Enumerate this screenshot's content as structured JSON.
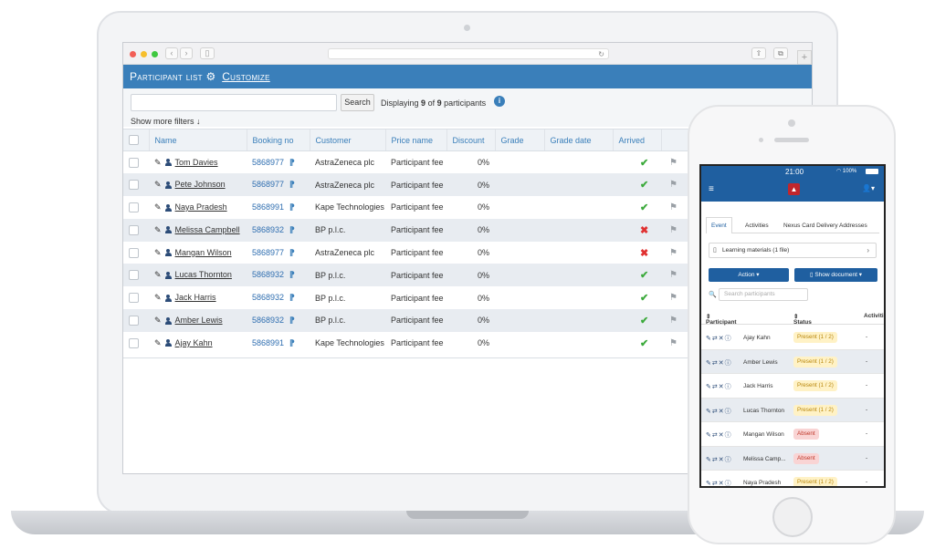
{
  "laptop": {
    "header": {
      "title": "Participant list",
      "customize_label": "Customize"
    },
    "search": {
      "placeholder": "",
      "button_label": "Search",
      "displaying_prefix": "Displaying",
      "shown": "9",
      "of_word": "of",
      "total": "9",
      "suffix": "participants"
    },
    "show_more_filters": "Show more filters",
    "columns": [
      "Name",
      "Booking no",
      "Customer",
      "Price name",
      "Discount",
      "Grade",
      "Grade date",
      "Arrived"
    ],
    "rows": [
      {
        "name": "Tom Davies",
        "booking": "5868977",
        "customer": "AstraZeneca plc",
        "price": "Participant fee",
        "discount": "0%",
        "arrived": "yes"
      },
      {
        "name": "Pete Johnson",
        "booking": "5868977",
        "customer": "AstraZeneca plc",
        "price": "Participant fee",
        "discount": "0%",
        "arrived": "yes"
      },
      {
        "name": "Naya Pradesh",
        "booking": "5868991",
        "customer": "Kape Technologies",
        "price": "Participant fee",
        "discount": "0%",
        "arrived": "yes"
      },
      {
        "name": "Melissa Campbell",
        "booking": "5868932",
        "customer": "BP p.l.c.",
        "price": "Participant fee",
        "discount": "0%",
        "arrived": "no"
      },
      {
        "name": "Mangan Wilson",
        "booking": "5868977",
        "customer": "AstraZeneca plc",
        "price": "Participant fee",
        "discount": "0%",
        "arrived": "no"
      },
      {
        "name": "Lucas Thornton",
        "booking": "5868932",
        "customer": "BP p.l.c.",
        "price": "Participant fee",
        "discount": "0%",
        "arrived": "yes"
      },
      {
        "name": "Jack Harris",
        "booking": "5868932",
        "customer": "BP p.l.c.",
        "price": "Participant fee",
        "discount": "0%",
        "arrived": "yes"
      },
      {
        "name": "Amber Lewis",
        "booking": "5868932",
        "customer": "BP p.l.c.",
        "price": "Participant fee",
        "discount": "0%",
        "arrived": "yes"
      },
      {
        "name": "Ajay Kahn",
        "booking": "5868991",
        "customer": "Kape Technologies",
        "price": "Participant fee",
        "discount": "0%",
        "arrived": "yes"
      }
    ]
  },
  "phone": {
    "status_time": "21:00",
    "battery": "100%",
    "tabs": [
      "Event",
      "Activities",
      "Nexus Card Delivery Addresses"
    ],
    "materials_label": "Learning materials (1 file)",
    "action_label": "Action",
    "show_document_label": "Show document",
    "search_placeholder": "Search participants",
    "columns": [
      "Participant",
      "Status",
      "Activiti"
    ],
    "rows": [
      {
        "name": "Ajay Kahn",
        "status": "Present (1 / 2)",
        "state": "present",
        "activity": "-"
      },
      {
        "name": "Amber Lewis",
        "status": "Present (1 / 2)",
        "state": "present",
        "activity": "-"
      },
      {
        "name": "Jack Harris",
        "status": "Present (1 / 2)",
        "state": "present",
        "activity": "-"
      },
      {
        "name": "Lucas Thornton",
        "status": "Present (1 / 2)",
        "state": "present",
        "activity": "-"
      },
      {
        "name": "Mangan Wilson",
        "status": "Absent",
        "state": "absent",
        "activity": "-"
      },
      {
        "name": "Melissa Camp...",
        "status": "Absent",
        "state": "absent",
        "activity": "-"
      },
      {
        "name": "Naya Pradesh",
        "status": "Present (1 / 2)",
        "state": "present",
        "activity": "-"
      }
    ]
  },
  "colors": {
    "accent": "#3a7fba",
    "phone_accent": "#1f5fa0",
    "ok": "#3caa3c",
    "error": "#e03131"
  }
}
